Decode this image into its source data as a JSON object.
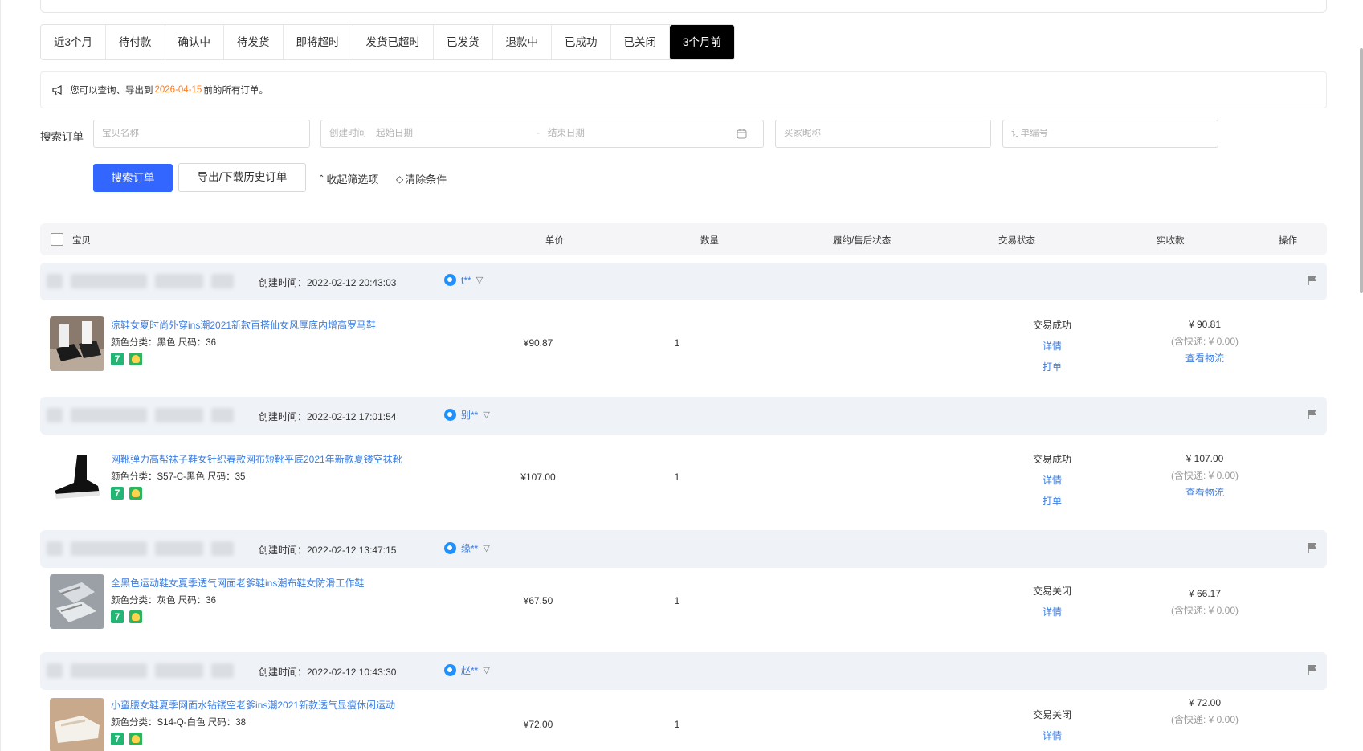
{
  "tabs": [
    "近3个月",
    "待付款",
    "确认中",
    "待发货",
    "即将超时",
    "发货已超时",
    "已发货",
    "退款中",
    "已成功",
    "已关闭",
    "3个月前"
  ],
  "notice": {
    "prefix": "您可以查询、导出到",
    "date": "2026-04-15",
    "suffix": "前的所有订单。"
  },
  "search": {
    "label": "搜索订单",
    "item_placeholder": "宝贝名称",
    "created_time_label": "创建时间",
    "start_placeholder": "起始日期",
    "separator": "-",
    "end_placeholder": "结束日期",
    "buyer_placeholder": "买家昵称",
    "order_placeholder": "订单编号",
    "search_button": "搜索订单",
    "export_button": "导出/下载历史订单",
    "collapse_link": "收起筛选项",
    "clear_link": "清除条件"
  },
  "table_header": {
    "item": "宝贝",
    "unit_price": "单价",
    "quantity": "数量",
    "after_sale": "履约/售后状态",
    "trade_status": "交易状态",
    "received": "实收款",
    "action": "操作"
  },
  "orders": [
    {
      "created": "创建时间：2022-02-12 20:43:03",
      "buyer": "t**",
      "title": "凉鞋女夏时尚外穿ins潮2021新款百搭仙女风厚底内增高罗马鞋",
      "sku": "颜色分类：黑色  尺码：36",
      "price": "¥90.87",
      "qty": "1",
      "status": "交易成功",
      "detail": "详情",
      "print": "打单",
      "amount": "¥ 90.81",
      "shipping": "(含快递: ¥ 0.00)",
      "logistics": "查看物流"
    },
    {
      "created": "创建时间：2022-02-12 17:01:54",
      "buyer": "别**",
      "title": "网靴弹力高帮袜子鞋女针织春款网布短靴平底2021年新款夏镂空袜靴",
      "sku": "颜色分类：S57-C-黑色  尺码：35",
      "price": "¥107.00",
      "qty": "1",
      "status": "交易成功",
      "detail": "详情",
      "print": "打单",
      "amount": "¥ 107.00",
      "shipping": "(含快递: ¥ 0.00)",
      "logistics": "查看物流"
    },
    {
      "created": "创建时间：2022-02-12 13:47:15",
      "buyer": "缘**",
      "title": "全黑色运动鞋女夏季透气网面老爹鞋ins潮布鞋女防滑工作鞋",
      "sku": "颜色分类：灰色  尺码：36",
      "price": "¥67.50",
      "qty": "1",
      "status": "交易关闭",
      "detail": "详情",
      "amount": "¥ 66.17",
      "shipping": "(含快递: ¥ 0.00)"
    },
    {
      "created": "创建时间：2022-02-12 10:43:30",
      "buyer": "赵**",
      "title": "小蛮腰女鞋夏季网面水钻镂空老爹ins潮2021新款透气显瘦休闲运动",
      "sku": "颜色分类：S14-Q-白色  尺码：38",
      "price": "¥72.00",
      "qty": "1",
      "status": "交易关闭",
      "detail": "详情",
      "amount": "¥ 72.00",
      "shipping": "(含快递: ¥ 0.00)"
    }
  ],
  "colors": {
    "accent": "#3366ff",
    "link": "#3d7ee0",
    "notice_date": "#ff7a1a",
    "active_tab": "#000000",
    "order_header_bg": "#eff2f7"
  }
}
